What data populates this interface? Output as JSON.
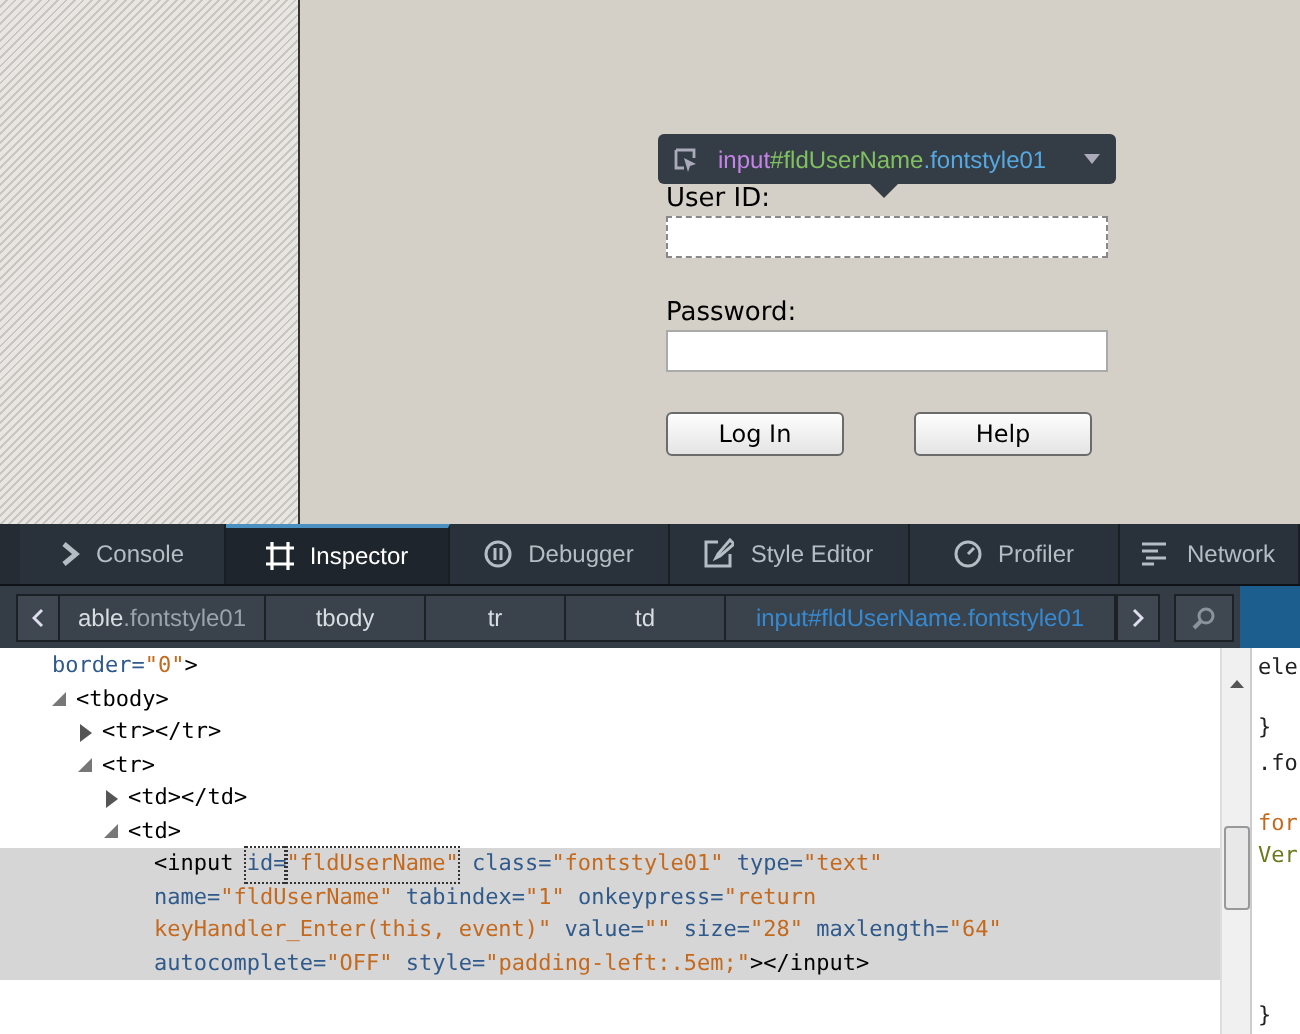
{
  "page": {
    "tooltip": {
      "tag": "input",
      "id": "#fldUserName",
      "cls": ".fontstyle01"
    },
    "form": [
      {
        "label": "User ID:",
        "highlighted": true
      },
      {
        "label": "Password:",
        "highlighted": false
      }
    ],
    "buttons": [
      "Log In",
      "Help"
    ]
  },
  "devtools": {
    "tabs": [
      {
        "label": "Console",
        "selected": false
      },
      {
        "label": "Inspector",
        "selected": true
      },
      {
        "label": "Debugger",
        "selected": false
      },
      {
        "label": "Style Editor",
        "selected": false
      },
      {
        "label": "Profiler",
        "selected": false
      },
      {
        "label": "Network",
        "selected": false
      }
    ],
    "breadcrumbs": [
      {
        "tag": "able",
        "cls": ".fontstyle01",
        "selected": false
      },
      {
        "tag": "tbody",
        "selected": false
      },
      {
        "tag": "tr",
        "selected": false
      },
      {
        "tag": "td",
        "selected": false
      },
      {
        "tag": "input",
        "id": "#fldUserName",
        "cls": ".fontstyle01",
        "selected": true
      }
    ],
    "markup": [
      {
        "lines": [
          [
            {
              "kind": "attr",
              "text": "border="
            },
            {
              "kind": "value",
              "text": "\"0\""
            },
            {
              "kind": "tag",
              "text": ">"
            }
          ]
        ],
        "selected": false
      },
      {
        "lines": [
          [
            {
              "kind": "tag",
              "text": "<tbody>"
            }
          ]
        ],
        "expanded": true,
        "selected": false,
        "children": [
          {
            "lines": [
              [
                {
                  "kind": "tag",
                  "text": "<tr></tr>"
                }
              ]
            ],
            "expanded": false,
            "selected": false
          },
          {
            "lines": [
              [
                {
                  "kind": "tag",
                  "text": "<tr>"
                }
              ]
            ],
            "expanded": true,
            "selected": false,
            "children": [
              {
                "lines": [
                  [
                    {
                      "kind": "tag",
                      "text": "<td></td>"
                    }
                  ]
                ],
                "expanded": false,
                "selected": false
              },
              {
                "lines": [
                  [
                    {
                      "kind": "tag",
                      "text": "<td>"
                    }
                  ]
                ],
                "expanded": true,
                "selected": false,
                "children": [
                  {
                    "lines": [
                      [
                        {
                          "kind": "tag",
                          "text": "<input "
                        },
                        {
                          "kind": "attr",
                          "text": "id=",
                          "focused": true
                        },
                        {
                          "kind": "value",
                          "text": "\"fldUserName\"",
                          "focused": true
                        },
                        {
                          "kind": "attr",
                          "text": " class="
                        },
                        {
                          "kind": "value",
                          "text": "\"fontstyle01\""
                        },
                        {
                          "kind": "attr",
                          "text": " type="
                        },
                        {
                          "kind": "value",
                          "text": "\"text\""
                        }
                      ],
                      [
                        {
                          "kind": "attr",
                          "text": "name="
                        },
                        {
                          "kind": "value",
                          "text": "\"fldUserName\""
                        },
                        {
                          "kind": "attr",
                          "text": " tabindex="
                        },
                        {
                          "kind": "value",
                          "text": "\"1\""
                        },
                        {
                          "kind": "attr",
                          "text": " onkeypress="
                        },
                        {
                          "kind": "value",
                          "text": "\"return"
                        }
                      ],
                      [
                        {
                          "kind": "value",
                          "text": "keyHandler_Enter(this, event)\""
                        },
                        {
                          "kind": "attr",
                          "text": " value="
                        },
                        {
                          "kind": "value",
                          "text": "\"\""
                        },
                        {
                          "kind": "attr",
                          "text": " size="
                        },
                        {
                          "kind": "value",
                          "text": "\"28\""
                        },
                        {
                          "kind": "attr",
                          "text": " maxlength="
                        },
                        {
                          "kind": "value",
                          "text": "\"64\""
                        }
                      ],
                      [
                        {
                          "kind": "attr",
                          "text": "autocomplete="
                        },
                        {
                          "kind": "value",
                          "text": "\"OFF\""
                        },
                        {
                          "kind": "attr",
                          "text": " style="
                        },
                        {
                          "kind": "value",
                          "text": "\"padding-left:.5em;\""
                        },
                        {
                          "kind": "tag",
                          "text": "></input>"
                        }
                      ]
                    ],
                    "selected": true
                  }
                ]
              }
            ]
          }
        ]
      }
    ],
    "rules": [
      {
        "kind": "plain",
        "text": "ele"
      },
      {
        "kind": "plain",
        "text": "}"
      },
      {
        "kind": "selector",
        "text": ".fo"
      },
      {
        "kind": "prop",
        "text": "for"
      },
      {
        "kind": "val",
        "text": "Ver"
      },
      {
        "kind": "plain",
        "text": "}"
      }
    ]
  }
}
